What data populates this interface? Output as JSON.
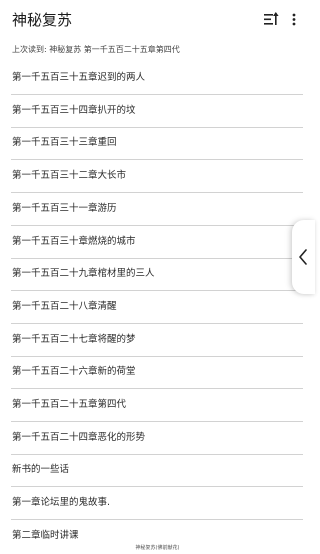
{
  "app_bar": {
    "title": "神秘复苏",
    "sort_icon": "sort-list-icon",
    "more_icon": "more-vertical-icon"
  },
  "last_read": {
    "label": "上次读到:",
    "chapter": "神秘复苏 第一千五百二十五章第四代"
  },
  "chapters": [
    "第一千五百三十五章迟到的两人",
    "第一千五百三十四章扒开的坟",
    "第一千五百三十三章重回",
    "第一千五百三十二章大长市",
    "第一千五百三十一章游历",
    "第一千五百三十章燃烧的城市",
    "第一千五百二十九章棺材里的三人",
    "第一千五百二十八章清醒",
    "第一千五百二十七章将醒的梦",
    "第一千五百二十六章新的荷堂",
    "第一千五百二十五章第四代",
    "第一千五百二十四章恶化的形势",
    "新书的一些话",
    "第一章论坛里的鬼故事.",
    "第二章临时讲课"
  ],
  "side_tab": {
    "icon": "chevron-left-icon"
  },
  "status_caption": "神秘复苏(佛前献花)",
  "colors": {
    "divider": "#d2d2d2",
    "text": "#2a2a2a",
    "background": "#ffffff"
  }
}
